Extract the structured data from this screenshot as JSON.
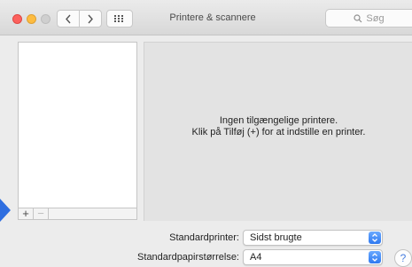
{
  "window": {
    "title": "Printere & scannere"
  },
  "toolbar": {
    "search_placeholder": "Søg"
  },
  "printers": [],
  "list_buttons": {
    "add": "+",
    "remove": "−"
  },
  "empty_state": {
    "line1": "Ingen tilgængelige printere.",
    "line2": "Klik på Tilføj (+) for at indstille en printer."
  },
  "settings": {
    "default_printer": {
      "label": "Standardprinter:",
      "value": "Sidst brugte"
    },
    "default_paper": {
      "label": "Standardpapirstørrelse:",
      "value": "A4"
    }
  },
  "help": {
    "label": "?"
  },
  "colors": {
    "accent": "#2f79f0",
    "highlight_arrow": "#2e6ee0"
  }
}
